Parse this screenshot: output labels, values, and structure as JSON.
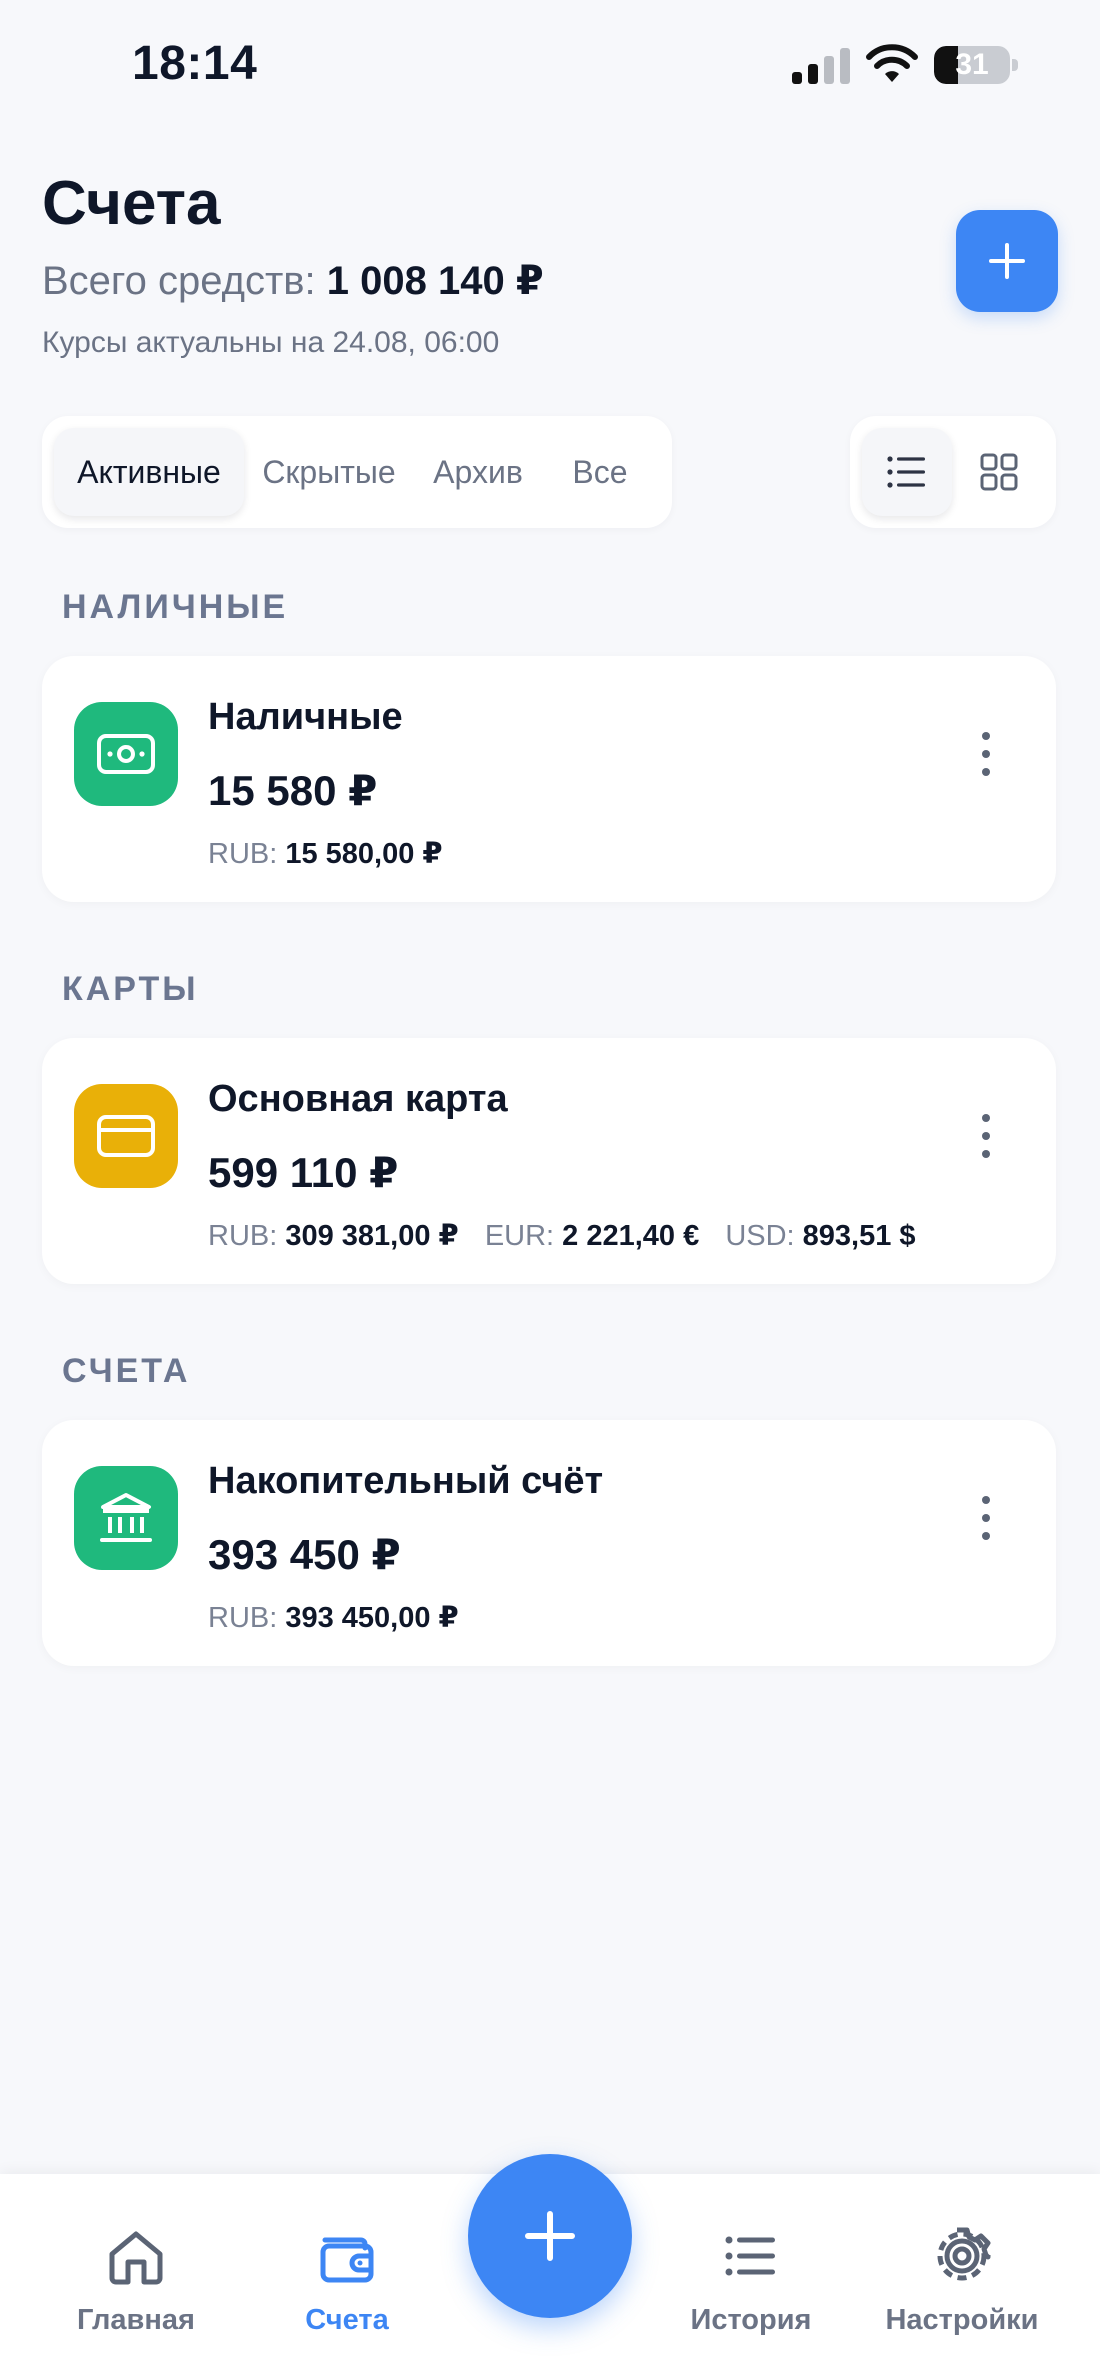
{
  "status_bar": {
    "time": "18:14",
    "battery_percent": "31"
  },
  "header": {
    "title": "Счета",
    "total_label": "Всего средств:",
    "total_value": "1 008 140 ₽",
    "rates_note": "Курсы актуальны на 24.08, 06:00",
    "add_icon": "plus-icon"
  },
  "filters": {
    "tabs": [
      "Активные",
      "Скрытые",
      "Архив",
      "Все"
    ],
    "selected": "Активные"
  },
  "view_toggle": {
    "options": [
      "list-icon",
      "grid-icon"
    ],
    "selected": "list-icon"
  },
  "sections": [
    {
      "title": "НАЛИЧНЫЕ",
      "accounts": [
        {
          "name": "Наличные",
          "amount": "15 580 ₽",
          "icon": "cash-icon",
          "icon_color": "#1fb97d",
          "currencies": [
            {
              "code": "RUB:",
              "value": "15 580,00 ₽"
            }
          ]
        }
      ]
    },
    {
      "title": "КАРТЫ",
      "accounts": [
        {
          "name": "Основная карта",
          "amount": "599 110 ₽",
          "icon": "card-icon",
          "icon_color": "#e9b008",
          "currencies": [
            {
              "code": "RUB:",
              "value": "309 381,00 ₽"
            },
            {
              "code": "EUR:",
              "value": "2 221,40 €"
            },
            {
              "code": "USD:",
              "value": "893,51 $"
            }
          ]
        }
      ]
    },
    {
      "title": "СЧЕТА",
      "accounts": [
        {
          "name": "Накопительный счёт",
          "amount": "393 450 ₽",
          "icon": "bank-icon",
          "icon_color": "#1fb97d",
          "currencies": [
            {
              "code": "RUB:",
              "value": "393 450,00 ₽"
            }
          ]
        }
      ]
    }
  ],
  "bottom_nav": {
    "items": [
      {
        "label": "Главная",
        "icon": "home-icon"
      },
      {
        "label": "Счета",
        "icon": "wallet-icon"
      },
      {
        "label": "История",
        "icon": "list-icon"
      },
      {
        "label": "Настройки",
        "icon": "gear-icon"
      }
    ],
    "selected": "Счета",
    "fab_icon": "plus-icon"
  },
  "colors": {
    "accent": "#3d86f4",
    "background": "#f7f8fb",
    "muted_text": "#6b7385",
    "section_title": "#6b7690"
  }
}
